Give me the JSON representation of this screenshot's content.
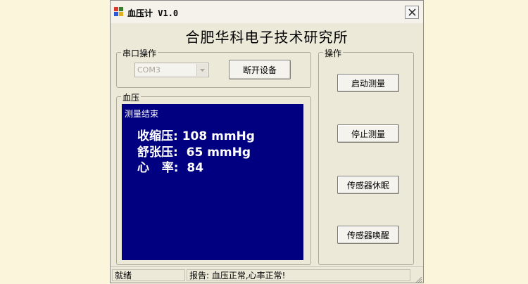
{
  "window": {
    "title": "血压计 V1.0",
    "organization": "合肥华科电子技术研究所"
  },
  "serial_group": {
    "label": "串口操作",
    "port_value": "COM3",
    "disconnect_button": "断开设备"
  },
  "pressure_group": {
    "label": "血压",
    "status": "测量结束",
    "systolic": "收缩压: 108 mmHg",
    "diastolic": "舒张压:  65 mmHg",
    "heart_rate": "心   率:  84"
  },
  "actions_group": {
    "label": "操作",
    "start_button": "启动测量",
    "stop_button": "停止测量",
    "sleep_button": "传感器休眠",
    "wake_button": "传感器唤醒"
  },
  "statusbar": {
    "state": "就绪",
    "report": "报告:  血压正常,心率正常!"
  },
  "colors": {
    "display_background": "#000080",
    "window_background": "#ece9d8",
    "desktop_background": "#fbf5dc"
  },
  "icons": [
    "app-icon",
    "close-icon",
    "dropdown-arrow-icon",
    "resize-grip-icon"
  ]
}
